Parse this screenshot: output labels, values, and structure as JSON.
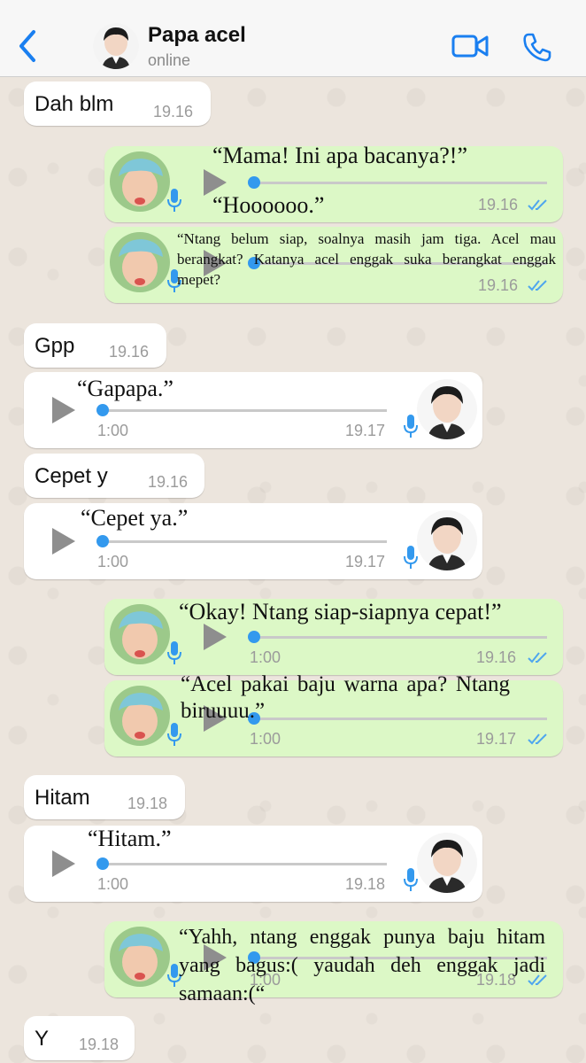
{
  "header": {
    "contact_name": "Papa acel",
    "status": "online"
  },
  "messages": {
    "m1": {
      "text": "Dah blm",
      "time": "19.16"
    },
    "m2": {
      "caption1": "“Mama! Ini apa bacanya?!”",
      "caption2": "“Hoooooo.”",
      "time": "19.16"
    },
    "m3": {
      "caption": "“Ntang belum siap, soalnya masih jam tiga. Acel mau berangkat? Katanya acel enggak suka berangkat enggak mepet?",
      "time": "19.16"
    },
    "m4": {
      "text": "Gpp",
      "time": "19.16"
    },
    "m5": {
      "caption": "“Gapapa.”",
      "duration": "1:00",
      "time": "19.17"
    },
    "m6": {
      "text": "Cepet y",
      "time": "19.16"
    },
    "m7": {
      "caption": "“Cepet ya.”",
      "duration": "1:00",
      "time": "19.17"
    },
    "m8": {
      "caption": "“Okay! Ntang siap-siapnya cepat!”",
      "duration": "1:00",
      "time": "19.16"
    },
    "m9": {
      "caption": "“Acel pakai baju warna apa? Ntang biruuuu.”",
      "duration": "1:00",
      "time": "19.17"
    },
    "m10": {
      "text": "Hitam",
      "time": "19.18"
    },
    "m11": {
      "caption": "“Hitam.”",
      "duration": "1:00",
      "time": "19.18"
    },
    "m12": {
      "caption": "“Yahh, ntang enggak punya baju hitam yang bagus:( yaudah deh enggak jadi samaan:(“",
      "duration": "1:00",
      "time": "19.18"
    },
    "m13": {
      "text": "Y",
      "time": "19.18"
    }
  },
  "colors": {
    "accent": "#1a7ff0",
    "incoming": "#ffffff",
    "outgoing": "#dcf8c6",
    "background": "#ece5dd",
    "progress": "#3399ee"
  },
  "icons": [
    "back-chevron-icon",
    "video-call-icon",
    "phone-icon",
    "play-icon",
    "mic-icon",
    "double-check-icon"
  ]
}
